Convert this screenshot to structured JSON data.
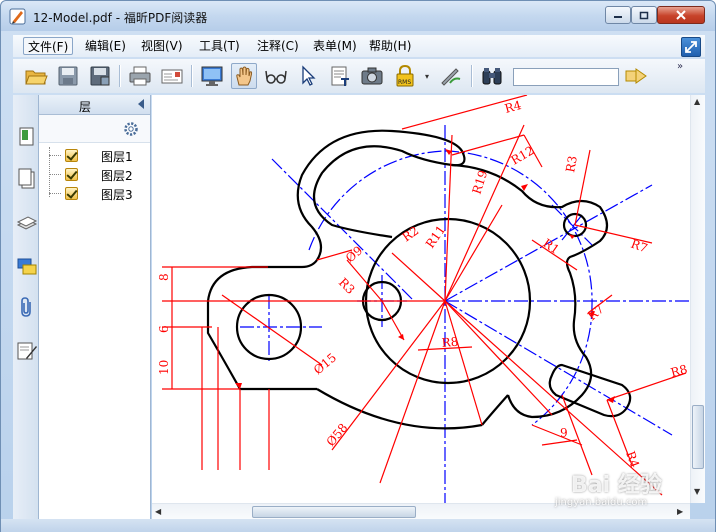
{
  "window": {
    "title": "12-Model.pdf - 福昕PDF阅读器"
  },
  "menu": {
    "items": [
      "文件(F)",
      "编辑(E)",
      "视图(V)",
      "工具(T)",
      "注释(C)",
      "表单(M)",
      "帮助(H)"
    ]
  },
  "toolbar": {
    "search_value": ""
  },
  "layers_panel": {
    "title": "层",
    "layers": [
      {
        "label": "图层1",
        "checked": true
      },
      {
        "label": "图层2",
        "checked": true
      },
      {
        "label": "图层3",
        "checked": true
      }
    ]
  },
  "drawing": {
    "labels": {
      "r4_top": "R4",
      "r12": "R12",
      "r19": "R19",
      "r3": "R3",
      "r2": "R2",
      "r11": "R11",
      "r1": "R1",
      "r7": "R7",
      "r7b": "R7",
      "r3b": "R3",
      "phi9": "Ø9",
      "r8": "R8",
      "phi15": "Ø15",
      "phi58": "Ø58",
      "r8b": "R8",
      "r4b": "R4",
      "dim9": "9",
      "dim8": "8",
      "dim6": "6",
      "dim10": "10"
    }
  },
  "watermark": {
    "brand": "Bai 经验",
    "url": "jingyan.baidu.com"
  },
  "colors": {
    "drawing_black": "#000000",
    "dimension_red": "#ff0000",
    "centerline_blue": "#0000ff",
    "title_bar": "#c4d8ef"
  }
}
